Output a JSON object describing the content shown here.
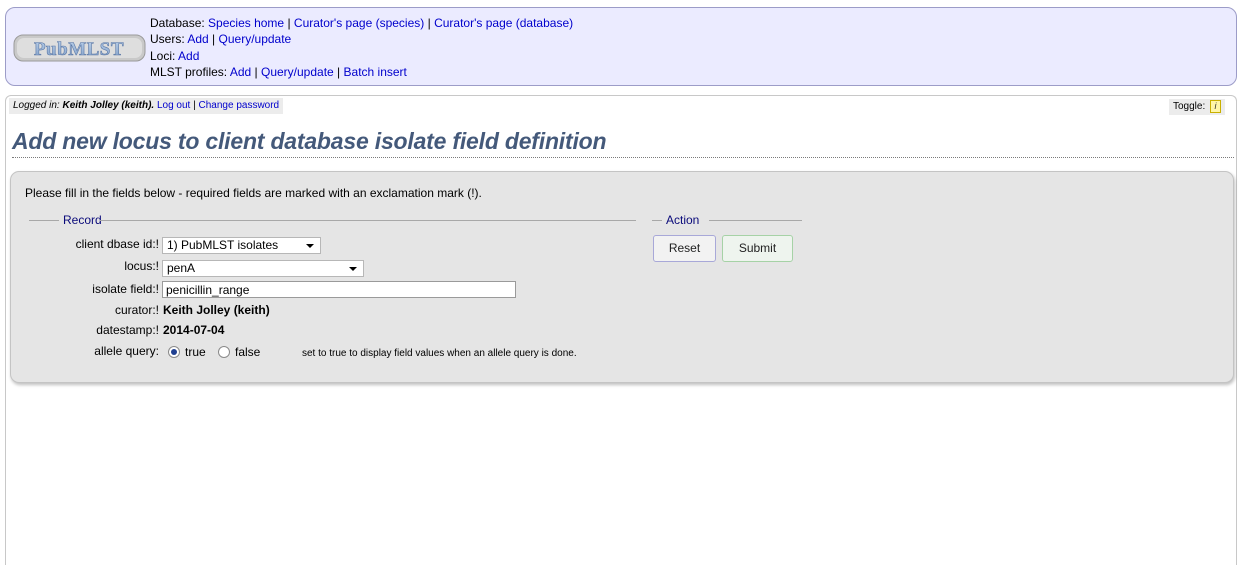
{
  "header": {
    "logo_text": "PubMLST",
    "database_label": "Database:",
    "database_links": [
      "Species home",
      "Curator's page (species)",
      "Curator's page (database)"
    ],
    "users_label": "Users:",
    "users_links": [
      "Add",
      "Query/update"
    ],
    "loci_label": "Loci:",
    "loci_links": [
      "Add"
    ],
    "profiles_label": "MLST profiles:",
    "profiles_links": [
      "Add",
      "Query/update",
      "Batch insert"
    ],
    "separator": "|"
  },
  "session": {
    "logged_in_prefix": "Logged in:",
    "user": "Keith Jolley (keith).",
    "logout": "Log out",
    "change_password": "Change password",
    "separator": "|",
    "toggle_label": "Toggle:",
    "toggle_icon_glyph": "i"
  },
  "page": {
    "title": "Add new locus to client database isolate field definition",
    "instruction": "Please fill in the fields below - required fields are marked with an exclamation mark (!)."
  },
  "record": {
    "legend": "Record",
    "client_dbase_label": "client dbase id:!",
    "client_dbase_value": "1) PubMLST isolates",
    "locus_label": "locus:!",
    "locus_value": "penA",
    "isolate_field_label": "isolate field:!",
    "isolate_field_value": "penicillin_range",
    "curator_label": "curator:!",
    "curator_value": "Keith Jolley (keith)",
    "datestamp_label": "datestamp:!",
    "datestamp_value": "2014-07-04",
    "allele_query_label": "allele query:",
    "allele_query_true": "true",
    "allele_query_false": "false",
    "allele_query_selected": "true",
    "allele_query_hint": "set to true to display field values when an allele query is done."
  },
  "action": {
    "legend": "Action",
    "reset_label": "Reset",
    "submit_label": "Submit"
  },
  "colors": {
    "title": "#44597a",
    "link": "#0000cc",
    "header_bg": "#ebebff",
    "panel_bg": "#e5e5e5",
    "legend_text": "#0a0a7a"
  }
}
